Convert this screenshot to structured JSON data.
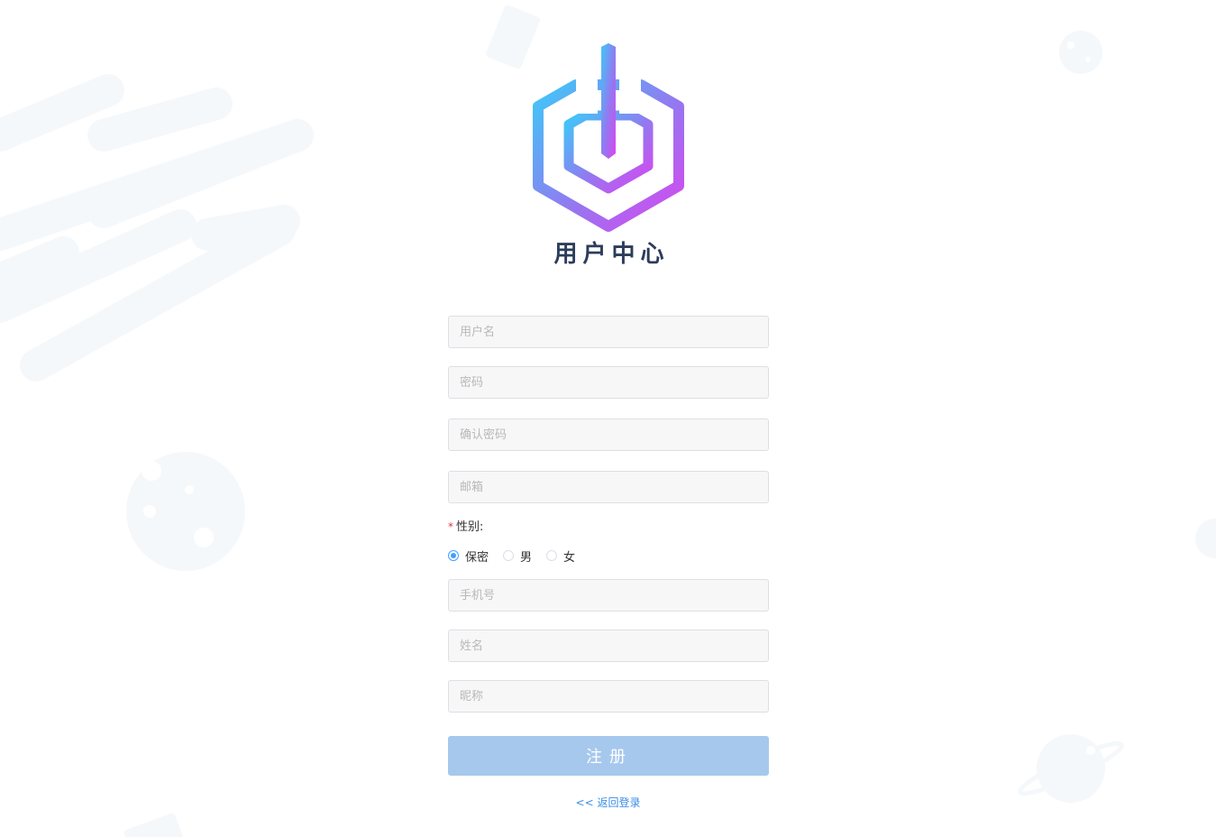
{
  "header": {
    "title": "用户中心"
  },
  "form": {
    "username_placeholder": "用户名",
    "password_placeholder": "密码",
    "confirm_password_placeholder": "确认密码",
    "email_placeholder": "邮箱",
    "gender": {
      "required_mark": "*",
      "label": "性别:",
      "options": [
        "保密",
        "男",
        "女"
      ],
      "selected": "保密"
    },
    "phone_placeholder": "手机号",
    "name_placeholder": "姓名",
    "nickname_placeholder": "昵称",
    "submit_label": "注册",
    "back_link": "<< 返回登录"
  },
  "colors": {
    "accent": "#409eff",
    "button": "#a6c8ec",
    "title": "#2d3c5a",
    "link": "#3a8ee6",
    "logo_gradient_start": "#3ec8f8",
    "logo_gradient_end": "#d946ef"
  }
}
